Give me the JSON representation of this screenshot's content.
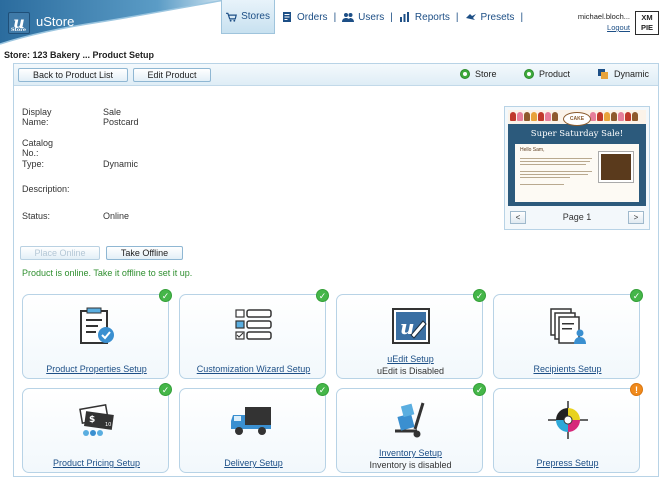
{
  "app": {
    "name": "uStore",
    "logo_letter": "u",
    "logo_sub": "Store"
  },
  "nav": {
    "items": [
      {
        "label": "Stores",
        "icon": "cart-icon",
        "active": true
      },
      {
        "label": "Orders",
        "icon": "orders-icon",
        "active": false
      },
      {
        "label": "Users",
        "icon": "users-icon",
        "active": false
      },
      {
        "label": "Reports",
        "icon": "reports-icon",
        "active": false
      },
      {
        "label": "Presets",
        "icon": "presets-icon",
        "active": false
      }
    ],
    "separator": "|"
  },
  "user": {
    "name": "michael.bloch...",
    "logout": "Logout"
  },
  "brand_mark": {
    "line1": "XM",
    "line2": "PIE"
  },
  "breadcrumb": "Store: 123 Bakery ... Product Setup",
  "toolbar": {
    "back_label": "Back to Product List",
    "edit_label": "Edit Product",
    "toggles": [
      {
        "label": "Store",
        "icon": "green-dot-icon"
      },
      {
        "label": "Product",
        "icon": "green-dot-icon"
      },
      {
        "label": "Dynamic",
        "icon": "dynamic-icon"
      }
    ]
  },
  "details": {
    "display_name_label": "Display Name:",
    "display_name": "Sale Postcard",
    "catalog_label": "Catalog No.:",
    "catalog": "",
    "type_label": "Type:",
    "type": "Dynamic",
    "description_label": "Description:",
    "description": "",
    "status_label": "Status:",
    "status": "Online"
  },
  "preview": {
    "logo_text": "CAKE",
    "banner": "Super Saturday Sale!",
    "greeting": "Hello Sam,",
    "page_label": "Page 1",
    "prev": "<",
    "next": ">"
  },
  "actions": {
    "place_online": "Place Online",
    "take_offline": "Take Offline",
    "message": "Product is online. Take it offline to set it up."
  },
  "tiles": [
    {
      "label": "Product Properties Setup",
      "sub": "",
      "status": "ok",
      "icon": "product-properties-icon"
    },
    {
      "label": "Customization Wizard Setup",
      "sub": "",
      "status": "ok",
      "icon": "customization-wizard-icon"
    },
    {
      "label": "uEdit Setup",
      "sub": "uEdit is Disabled",
      "status": "ok",
      "icon": "uedit-icon"
    },
    {
      "label": "Recipients Setup",
      "sub": "",
      "status": "ok",
      "icon": "recipients-icon"
    },
    {
      "label": "Product Pricing Setup",
      "sub": "",
      "status": "ok",
      "icon": "pricing-icon"
    },
    {
      "label": "Delivery Setup",
      "sub": "",
      "status": "ok",
      "icon": "delivery-truck-icon"
    },
    {
      "label": "Inventory Setup",
      "sub": "Inventory is disabled",
      "status": "ok",
      "icon": "inventory-cart-icon"
    },
    {
      "label": "Prepress Setup",
      "sub": "",
      "status": "warning",
      "icon": "prepress-target-icon"
    }
  ],
  "badge_glyphs": {
    "ok": "✓",
    "warning": "!"
  },
  "colors": {
    "brand_blue": "#1d4f86",
    "ok_green": "#45b649",
    "warning_orange": "#f08a1c",
    "message_green": "#2f8f2f",
    "panel_border": "#b8d3e6"
  }
}
